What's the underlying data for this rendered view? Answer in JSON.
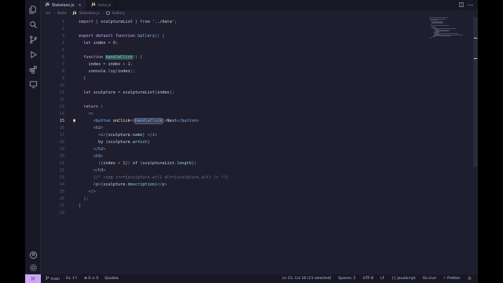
{
  "tabs": [
    {
      "icon": "JS",
      "label": "Stateless.js",
      "active": true,
      "close": "×"
    },
    {
      "icon": "JS",
      "label": "data.js",
      "active": false,
      "close": ""
    }
  ],
  "breadcrumb": [
    "src",
    "State",
    "Stateless.js",
    "Gallery"
  ],
  "code_lines": [
    {
      "n": "1",
      "tokens": [
        [
          "kw",
          "import"
        ],
        [
          "pun",
          " { "
        ],
        [
          "var",
          "sculptureList"
        ],
        [
          "pun",
          " } "
        ],
        [
          "kw",
          "from"
        ],
        [
          "str",
          " '../data'"
        ],
        [
          "pun",
          ";"
        ]
      ]
    },
    {
      "n": "2",
      "tokens": []
    },
    {
      "n": "3",
      "tokens": [
        [
          "kw",
          "export"
        ],
        [
          "kw",
          " default"
        ],
        [
          "kw",
          " function"
        ],
        [
          "fn",
          " Gallery"
        ],
        [
          "pun",
          "() {"
        ]
      ]
    },
    {
      "n": "4",
      "tokens": [
        [
          "kw",
          "  let"
        ],
        [
          "var",
          " index"
        ],
        [
          "pun",
          " = "
        ],
        [
          "num",
          "0"
        ],
        [
          "pun",
          ";"
        ]
      ]
    },
    {
      "n": "5",
      "tokens": []
    },
    {
      "n": "6",
      "tokens": [
        [
          "kw",
          "  function "
        ],
        [
          "fn hl",
          "handleClick"
        ],
        [
          "pun",
          "() {"
        ]
      ]
    },
    {
      "n": "7",
      "tokens": [
        [
          "var",
          "    index"
        ],
        [
          "pun",
          " = "
        ],
        [
          "var",
          "index"
        ],
        [
          "pun",
          " + "
        ],
        [
          "num",
          "1"
        ],
        [
          "pun",
          ";"
        ]
      ]
    },
    {
      "n": "8",
      "tokens": [
        [
          "var",
          "    console"
        ],
        [
          "pun",
          "."
        ],
        [
          "fn",
          "log"
        ],
        [
          "pun",
          "("
        ],
        [
          "var",
          "index"
        ],
        [
          "pun",
          ");"
        ]
      ]
    },
    {
      "n": "9",
      "tokens": [
        [
          "pun",
          "  }"
        ]
      ]
    },
    {
      "n": "10",
      "tokens": []
    },
    {
      "n": "11",
      "tokens": [
        [
          "kw",
          "  let"
        ],
        [
          "var",
          " sculpture"
        ],
        [
          "pun",
          " = "
        ],
        [
          "var",
          "sculptureList"
        ],
        [
          "pun",
          "["
        ],
        [
          "var",
          "index"
        ],
        [
          "pun",
          "];"
        ]
      ]
    },
    {
      "n": "12",
      "tokens": []
    },
    {
      "n": "13",
      "tokens": [
        [
          "kw",
          "  return"
        ],
        [
          "pun",
          " ("
        ]
      ]
    },
    {
      "n": "14",
      "tokens": [
        [
          "pun",
          "    <>"
        ]
      ]
    },
    {
      "n": "15",
      "tokens": [
        [
          "pun",
          "      <"
        ],
        [
          "tag",
          "button"
        ],
        [
          "attr",
          " onClick"
        ],
        [
          "pun",
          "={"
        ],
        [
          "fn hl2",
          "handleClick"
        ],
        [
          "pun",
          "}>"
        ],
        [
          "var",
          "Next"
        ],
        [
          "pun",
          "</"
        ],
        [
          "tag",
          "button"
        ],
        [
          "pun",
          ">"
        ]
      ]
    },
    {
      "n": "16",
      "tokens": [
        [
          "pun",
          "      <"
        ],
        [
          "tag",
          "h2"
        ],
        [
          "pun",
          ">"
        ]
      ]
    },
    {
      "n": "17",
      "tokens": [
        [
          "pun",
          "        <"
        ],
        [
          "tag",
          "i"
        ],
        [
          "pun",
          ">{"
        ],
        [
          "var",
          "sculpture"
        ],
        [
          "pun",
          "."
        ],
        [
          "prop",
          "name"
        ],
        [
          "pun",
          "} </"
        ],
        [
          "tag",
          "i"
        ],
        [
          "pun",
          ">"
        ]
      ]
    },
    {
      "n": "18",
      "tokens": [
        [
          "var",
          "        by "
        ],
        [
          "pun",
          "{"
        ],
        [
          "var",
          "sculpture"
        ],
        [
          "pun",
          "."
        ],
        [
          "prop",
          "artist"
        ],
        [
          "pun",
          "}"
        ]
      ]
    },
    {
      "n": "19",
      "tokens": [
        [
          "pun",
          "      </"
        ],
        [
          "tag",
          "h2"
        ],
        [
          "pun",
          ">"
        ]
      ]
    },
    {
      "n": "20",
      "tokens": [
        [
          "pun",
          "      <"
        ],
        [
          "tag",
          "h3"
        ],
        [
          "pun",
          ">"
        ]
      ]
    },
    {
      "n": "21",
      "tokens": [
        [
          "pun",
          "        ({"
        ],
        [
          "var",
          "index"
        ],
        [
          "pun",
          " + "
        ],
        [
          "num",
          "1"
        ],
        [
          "pun",
          "}) "
        ],
        [
          "var",
          "of"
        ],
        [
          "pun",
          " {"
        ],
        [
          "var",
          "sculptureList"
        ],
        [
          "pun",
          "."
        ],
        [
          "prop",
          "length"
        ],
        [
          "pun",
          "})"
        ]
      ]
    },
    {
      "n": "22",
      "tokens": [
        [
          "pun",
          "      </"
        ],
        [
          "tag",
          "h3"
        ],
        [
          "pun",
          ">"
        ]
      ]
    },
    {
      "n": "23",
      "tokens": [
        [
          "cmt",
          "      {/* <img src={sculpture.url} alt={sculpture.alt} /> */}"
        ]
      ]
    },
    {
      "n": "24",
      "tokens": [
        [
          "pun",
          "      <"
        ],
        [
          "tag",
          "p"
        ],
        [
          "pun",
          ">{"
        ],
        [
          "var",
          "sculpture"
        ],
        [
          "pun",
          "."
        ],
        [
          "prop",
          "description"
        ],
        [
          "pun",
          "}</"
        ],
        [
          "tag",
          "p"
        ],
        [
          "pun",
          ">"
        ]
      ]
    },
    {
      "n": "25",
      "tokens": [
        [
          "pun",
          "    </>"
        ]
      ]
    },
    {
      "n": "26",
      "tokens": [
        [
          "pun",
          "  );"
        ]
      ]
    },
    {
      "n": "27",
      "tokens": [
        [
          "pun",
          "}"
        ]
      ]
    },
    {
      "n": "28",
      "tokens": []
    }
  ],
  "current_line": "15",
  "lightbulb_icon": "lightbulb-icon",
  "status": {
    "branch": "main",
    "sync": "0↓ 1↑",
    "errors": "0",
    "warnings": "0",
    "quokka": "Quokka",
    "position": "Ln 15, Col 30 (11 selected)",
    "spaces": "Spaces: 2",
    "encoding": "UTF-8",
    "eol": "LF",
    "language": "{} JavaScript",
    "golive": "Go Live",
    "prettier": "✓ Prettier"
  },
  "colors": {
    "accent": "#cba6f7",
    "background": "#1e1e2e"
  }
}
